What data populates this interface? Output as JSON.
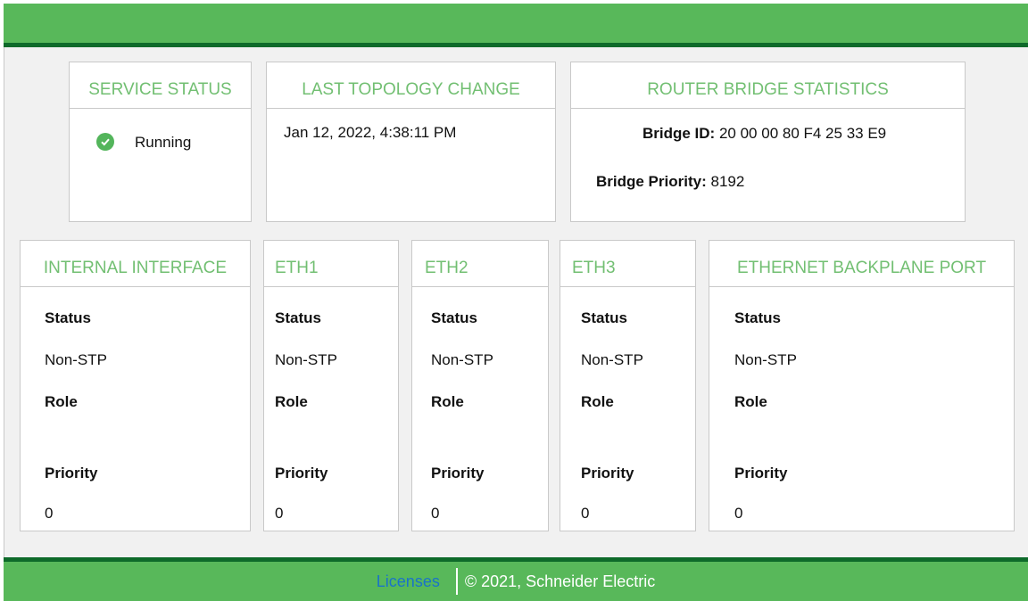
{
  "service_status": {
    "title": "SERVICE STATUS",
    "state": "Running",
    "state_icon": "check-circle-icon",
    "state_color": "#53b55b"
  },
  "topology": {
    "title": "LAST TOPOLOGY CHANGE",
    "timestamp": "Jan 12, 2022, 4:38:11 PM"
  },
  "bridge_stats": {
    "title": "ROUTER BRIDGE STATISTICS",
    "bridge_id_label": "Bridge ID:",
    "bridge_id": "20 00 00 80 F4 25 33 E9",
    "bridge_priority_label": "Bridge Priority:",
    "bridge_priority": "8192"
  },
  "field_labels": {
    "status": "Status",
    "role": "Role",
    "priority": "Priority"
  },
  "ports": [
    {
      "title": "INTERNAL INTERFACE",
      "status": "Non-STP",
      "role": "",
      "priority": "0"
    },
    {
      "title": "ETH1",
      "status": "Non-STP",
      "role": "",
      "priority": "0"
    },
    {
      "title": "ETH2",
      "status": "Non-STP",
      "role": "",
      "priority": "0"
    },
    {
      "title": "ETH3",
      "status": "Non-STP",
      "role": "",
      "priority": "0"
    },
    {
      "title": "ETHERNET BACKPLANE PORT",
      "status": "Non-STP",
      "role": "",
      "priority": "0"
    }
  ],
  "footer": {
    "licenses_link": "Licenses",
    "copyright": "© 2021, Schneider Electric"
  },
  "colors": {
    "header_green": "#58b85a",
    "dark_green_border": "#0e6a2a",
    "title_green": "#72bf72",
    "link_blue": "#1a73c8"
  }
}
